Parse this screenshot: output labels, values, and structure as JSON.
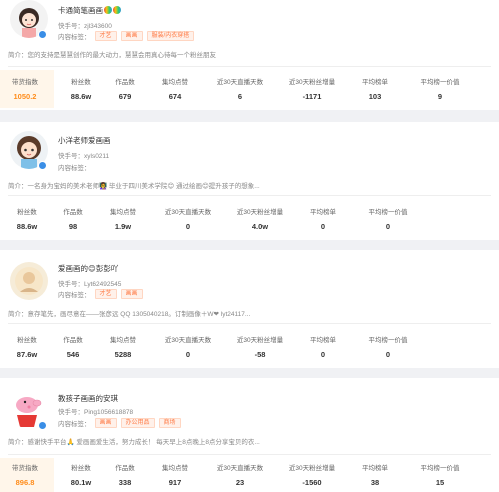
{
  "accounts": [
    {
      "name": "卡通简笔画画",
      "kuaishou_id": "快手号：zjl343600",
      "tags_label": "内容标签：",
      "tags": [
        "才艺",
        "画画",
        "服装/内衣穿搭"
      ],
      "intro": "简介：您的支持是慧慧创作的最大动力，慧慧会用真心待每一个粉丝朋友",
      "stats": [
        {
          "label": "带货指数",
          "value": "1050.2",
          "highlight": true
        },
        {
          "label": "粉丝数",
          "value": "88.6w"
        },
        {
          "label": "作品数",
          "value": "679"
        },
        {
          "label": "集均点赞",
          "value": "674"
        },
        {
          "label": "近30天直播天数",
          "value": "6"
        },
        {
          "label": "近30天粉丝增量",
          "value": "-1171"
        },
        {
          "label": "平均榜单",
          "value": "103"
        },
        {
          "label": "平均榜一价值",
          "value": "9"
        }
      ]
    },
    {
      "name": "小洋老师爱画画",
      "kuaishou_id": "快手号：xyls0211",
      "tags_label": "内容标签：",
      "tags": [],
      "intro": "简介：一名身为宝妈的美术老师👩‍🏫 毕业于四川美术学院😊 通过绘画😊提升孩子的想象...",
      "stats": [
        {
          "label": "粉丝数",
          "value": "88.6w"
        },
        {
          "label": "作品数",
          "value": "98"
        },
        {
          "label": "集均点赞",
          "value": "1.9w"
        },
        {
          "label": "近30天直播天数",
          "value": "0"
        },
        {
          "label": "近30天粉丝增量",
          "value": "4.0w"
        },
        {
          "label": "平均榜单",
          "value": "0"
        },
        {
          "label": "平均榜一价值",
          "value": "0"
        }
      ]
    },
    {
      "name": "爱画画的😊彭彭吖",
      "kuaishou_id": "快手号：Lyt62492545",
      "tags_label": "内容标签：",
      "tags": [
        "才艺",
        "画画"
      ],
      "intro": "简介：意存笔先，画尽意在——张彦远 QQ 1305040218。订制画像＋W❤ lyt24117...",
      "stats": [
        {
          "label": "粉丝数",
          "value": "87.6w"
        },
        {
          "label": "作品数",
          "value": "546"
        },
        {
          "label": "集均点赞",
          "value": "5288"
        },
        {
          "label": "近30天直播天数",
          "value": "0"
        },
        {
          "label": "近30天粉丝增量",
          "value": "-58"
        },
        {
          "label": "平均榜单",
          "value": "0"
        },
        {
          "label": "平均榜一价值",
          "value": "0"
        }
      ]
    },
    {
      "name": "教孩子画画的安琪",
      "kuaishou_id": "快手号：Ping1056618878",
      "tags_label": "内容标签：",
      "tags": [
        "画画",
        "办公用品",
        "商场"
      ],
      "intro": "简介：感谢快手平台🙏 爱画画爱生活，努力成长！ 每天早上8点晚上8点分享宝贝的衣...",
      "stats": [
        {
          "label": "带货指数",
          "value": "896.8",
          "highlight": true
        },
        {
          "label": "粉丝数",
          "value": "80.1w"
        },
        {
          "label": "作品数",
          "value": "338"
        },
        {
          "label": "集均点赞",
          "value": "917"
        },
        {
          "label": "近30天直播天数",
          "value": "23"
        },
        {
          "label": "近30天粉丝增量",
          "value": "-1560"
        },
        {
          "label": "平均榜单",
          "value": "38"
        },
        {
          "label": "平均榜一价值",
          "value": "15"
        }
      ]
    }
  ]
}
